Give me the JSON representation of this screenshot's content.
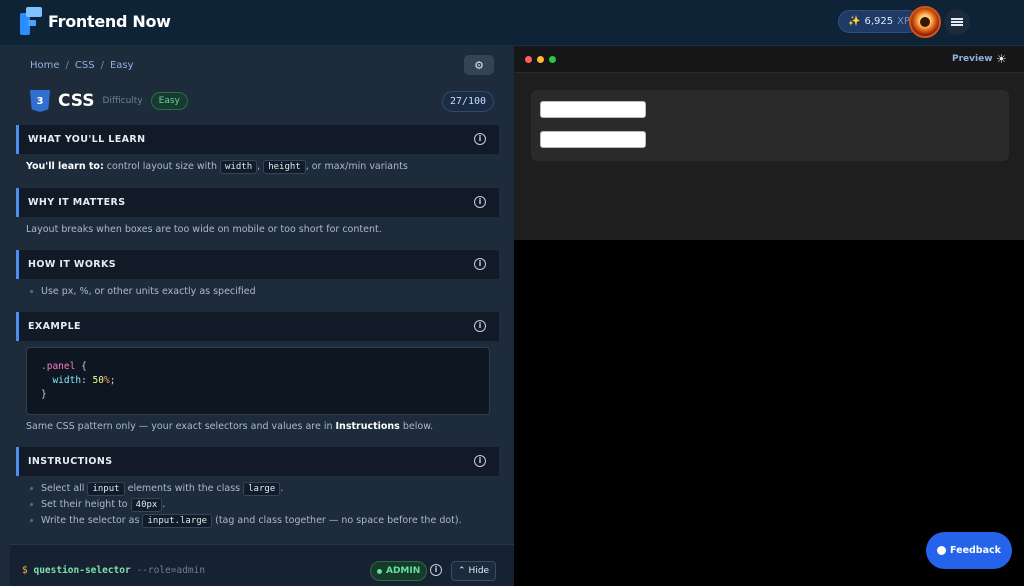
{
  "header": {
    "brand": "Frontend Now",
    "xp_value": "6,925",
    "xp_unit": "XP",
    "xp_icon": "sparkle-icon",
    "menu_icon": "hamburger-icon"
  },
  "breadcrumb": [
    "Home",
    "CSS",
    "Easy"
  ],
  "lesson": {
    "title": "CSS",
    "difficulty_label": "Difficulty",
    "difficulty": "Easy",
    "progress": "27/100"
  },
  "sections": {
    "learn": {
      "heading": "WHAT YOU'LL LEARN",
      "lead": "You'll learn to:",
      "text1": "control layout size with",
      "code1": "width",
      "code2": "height",
      "text2": ", or max/min variants"
    },
    "matters": {
      "heading": "WHY IT MATTERS",
      "text": "Layout breaks when boxes are too wide on mobile or too short for content."
    },
    "works": {
      "heading": "HOW IT WORKS",
      "bullet": "Use px, %, or other units exactly as specified"
    },
    "example": {
      "heading": "EXAMPLE",
      "code_selector": ".panel",
      "code_open": "{",
      "code_prop": "width",
      "code_value": "50",
      "code_unit": "%",
      "code_close": "}",
      "note_prefix": "Same CSS pattern only — your exact selectors and values are in",
      "note_bold": "Instructions",
      "note_suffix": "below."
    },
    "instructions": {
      "heading": "INSTRUCTIONS",
      "b1_pre": "Select all",
      "b1_code": "input",
      "b1_mid": "elements with the class",
      "b1_code2": "large",
      "b1_post": ".",
      "b2_pre": "Set their height to",
      "b2_code": "40px",
      "b2_post": ".",
      "b3_pre": "Write the selector as",
      "b3_code": "input.large",
      "b3_post": "(tag and class together — no space before the dot)."
    }
  },
  "terminal": {
    "prompt": "$",
    "command": "question-selector",
    "arg": "--role=admin",
    "badge": "ADMIN",
    "hide_label": "Hide"
  },
  "preview": {
    "label": "Preview",
    "theme_icon": "sun-icon"
  },
  "feedback": {
    "label": "Feedback"
  },
  "colors": {
    "accent": "#4d8ff0",
    "success": "#5ee39a",
    "feedback_bg": "#2563eb"
  }
}
